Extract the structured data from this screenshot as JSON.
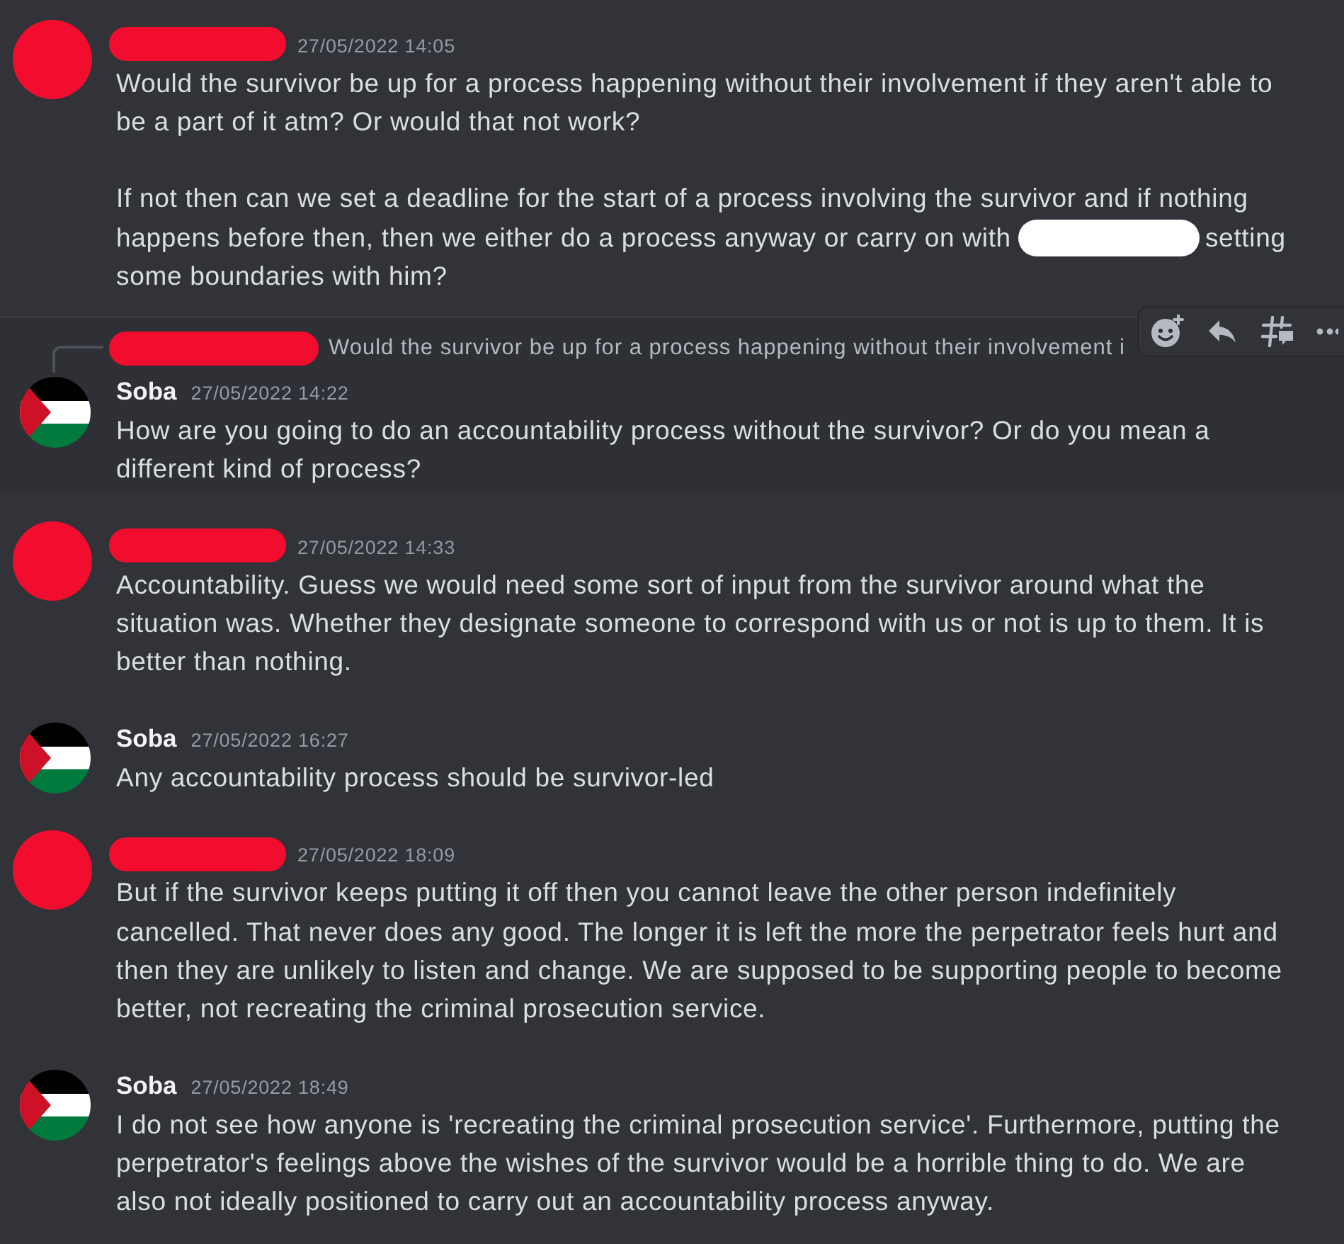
{
  "messages": [
    {
      "author": {
        "kind": "redacted"
      },
      "timestamp": "27/05/2022 14:05",
      "hovered": false,
      "paragraphs": [
        [
          {
            "kind": "text",
            "text": "Would the survivor be up for a process happening without their involvement if they aren't able to be a part of it atm? Or would that not work?"
          }
        ],
        [
          {
            "kind": "text",
            "text": "If not then can we set a deadline for the start of a process involving the survivor and if nothing happens before then, then we either do a process anyway or carry on with"
          },
          {
            "kind": "redaction"
          },
          {
            "kind": "text",
            "text": "setting some boundaries with him?"
          }
        ]
      ]
    },
    {
      "author": {
        "kind": "named",
        "name": "Soba"
      },
      "timestamp": "27/05/2022 14:22",
      "hovered": true,
      "reply_to": {
        "author": {
          "kind": "redacted"
        },
        "text": "Would the survivor be up for a process happening without their involvement i"
      },
      "paragraphs": [
        [
          {
            "kind": "text",
            "text": "How are you going to do an accountability process without the survivor? Or do you mean a different kind of process?"
          }
        ]
      ]
    },
    {
      "author": {
        "kind": "redacted"
      },
      "timestamp": "27/05/2022 14:33",
      "hovered": false,
      "paragraphs": [
        [
          {
            "kind": "text",
            "text": "Accountability. Guess we would need some sort of input from the survivor around what the situation was. Whether they designate someone to correspond with us or not is up to them. It is better than nothing."
          }
        ]
      ]
    },
    {
      "author": {
        "kind": "named",
        "name": "Soba"
      },
      "timestamp": "27/05/2022 16:27",
      "hovered": false,
      "paragraphs": [
        [
          {
            "kind": "text",
            "text": "Any accountability process should be survivor-led"
          }
        ]
      ]
    },
    {
      "author": {
        "kind": "redacted"
      },
      "timestamp": "27/05/2022 18:09",
      "hovered": false,
      "paragraphs": [
        [
          {
            "kind": "text",
            "text": "But if the survivor keeps putting it off then you cannot leave the other person indefinitely cancelled. That never does any good. The longer it is left the more the perpetrator feels hurt and then they are unlikely to listen and change. We are supposed to be supporting people to become better, not recreating the criminal prosecution service."
          }
        ]
      ]
    },
    {
      "author": {
        "kind": "named",
        "name": "Soba"
      },
      "timestamp": "27/05/2022 18:49",
      "hovered": false,
      "paragraphs": [
        [
          {
            "kind": "text",
            "text": "I do not see how anyone is 'recreating the criminal prosecution service'. Furthermore, putting the perpetrator's feelings above the wishes of the survivor would be a horrible thing to do. We are also not ideally positioned to carry out an accountability process anyway."
          }
        ]
      ]
    }
  ]
}
